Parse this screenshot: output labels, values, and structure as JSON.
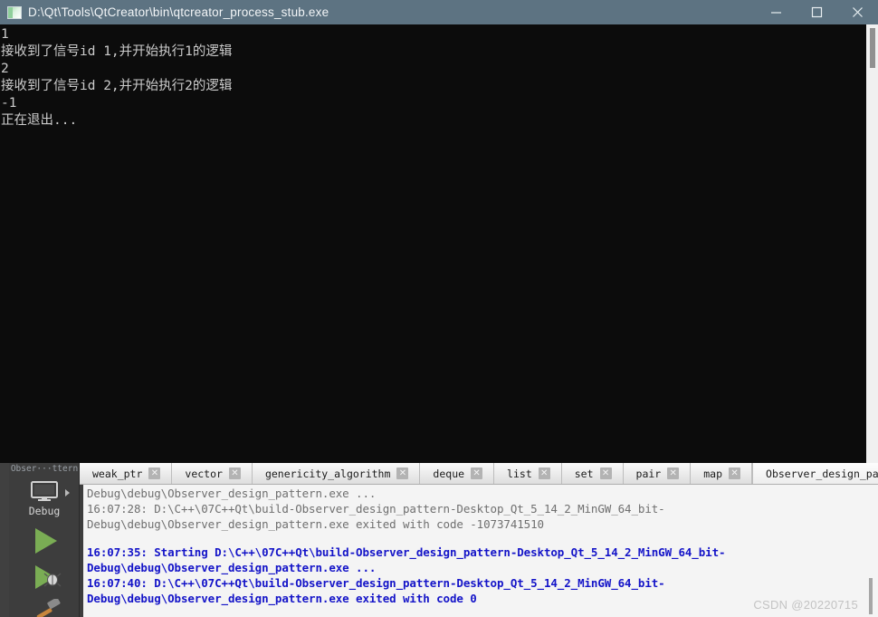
{
  "window": {
    "title": "D:\\Qt\\Tools\\QtCreator\\bin\\qtcreator_process_stub.exe",
    "icon": "app-window-icon",
    "minimize_label": "—",
    "maximize_label": "□",
    "close_label": "✕"
  },
  "console": {
    "lines": [
      "1",
      "接收到了信号id 1,并开始执行1的逻辑",
      "2",
      "接收到了信号id 2,并开始执行2的逻辑",
      "-1",
      "正在退出..."
    ]
  },
  "qt": {
    "kit": {
      "project_name": "Obser···ttern",
      "mode_label": "Debug",
      "monitor_icon": "desktop-monitor-icon",
      "expand_icon": "chevron-right-icon",
      "run_icon": "run-play-icon",
      "debug_icon": "debug-play-bug-icon",
      "build_icon": "build-hammer-icon"
    },
    "tabs": [
      {
        "label": "weak_ptr",
        "active": false,
        "close": "✕"
      },
      {
        "label": "vector",
        "active": false,
        "close": "✕"
      },
      {
        "label": "genericity_algorithm",
        "active": false,
        "close": "✕"
      },
      {
        "label": "deque",
        "active": false,
        "close": "✕"
      },
      {
        "label": "list",
        "active": false,
        "close": "✕"
      },
      {
        "label": "set",
        "active": false,
        "close": "✕"
      },
      {
        "label": "pair",
        "active": false,
        "close": "✕"
      },
      {
        "label": "map",
        "active": false,
        "close": "✕"
      },
      {
        "label": "Observer_design_pattern",
        "active": true,
        "close": "✕"
      }
    ],
    "tab_nav": {
      "prev_icon": "arrow-left-icon",
      "next_icon": "arrow-right-icon"
    },
    "output": [
      {
        "text": "Debug\\debug\\Observer_design_pattern.exe ...",
        "style": "gray"
      },
      {
        "text": "16:07:28: D:\\C++\\07C++Qt\\build-Observer_design_pattern-Desktop_Qt_5_14_2_MinGW_64_bit-",
        "style": "gray"
      },
      {
        "text": "Debug\\debug\\Observer_design_pattern.exe exited with code -1073741510",
        "style": "gray"
      },
      {
        "text": "",
        "style": "spacer"
      },
      {
        "text": "16:07:35: Starting D:\\C++\\07C++Qt\\build-Observer_design_pattern-Desktop_Qt_5_14_2_MinGW_64_bit-",
        "style": "blue"
      },
      {
        "text": "Debug\\debug\\Observer_design_pattern.exe ...",
        "style": "blue"
      },
      {
        "text": "16:07:40: D:\\C++\\07C++Qt\\build-Observer_design_pattern-Desktop_Qt_5_14_2_MinGW_64_bit-",
        "style": "blue"
      },
      {
        "text": "Debug\\debug\\Observer_design_pattern.exe exited with code 0",
        "style": "blue"
      }
    ]
  },
  "watermark": {
    "text": "CSDN @20220715"
  },
  "colors": {
    "titlebar": "#5d7382",
    "console_bg": "#0c0c0c",
    "console_fg": "#cccccc",
    "qt_sidebar": "#3d3d3d",
    "output_gray": "#6f6f6f",
    "output_blue": "#1414c8",
    "active_close": "#d9522f",
    "run_green": "#7aad54"
  }
}
